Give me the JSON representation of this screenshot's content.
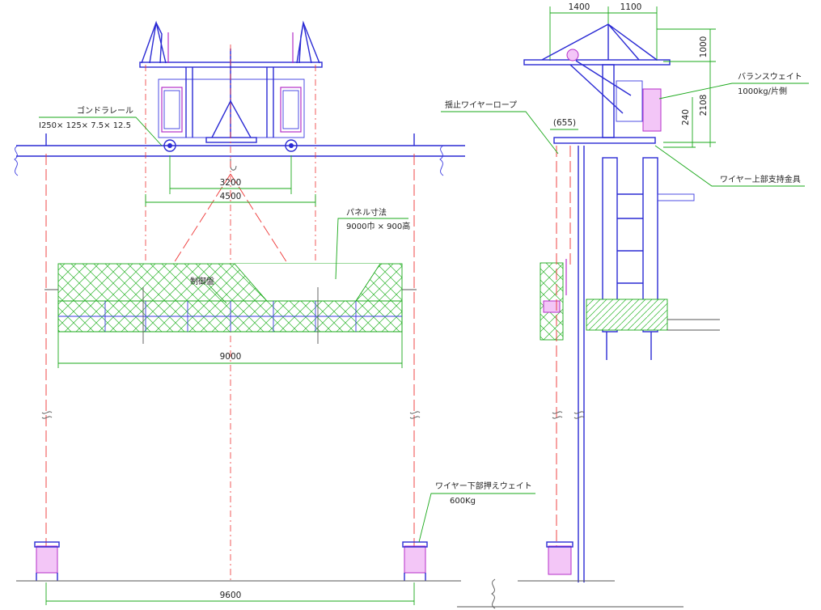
{
  "front_view": {
    "rail_label": "ゴンドラレール",
    "rail_spec": "I250× 125× 7.5× 12.5",
    "dim_inner": "3200",
    "dim_outer": "4500",
    "panel_label": "パネル寸法",
    "panel_size": "9000巾 × 900高",
    "control_panel": "制御盤",
    "dim_panel": "9000",
    "weight_label": "ワイヤー下部押えウェイト",
    "weight_value": "600Kg",
    "dim_total": "9600"
  },
  "side_view": {
    "dim_a": "1400",
    "dim_b": "1100",
    "dim_height1": "1000",
    "dim_height2": "2108",
    "dim_height3": "240",
    "dim_offset": "(655)",
    "balance_label": "バランスウェイト",
    "balance_value": "1000kg/片側",
    "rope_label": "揺止ワイヤーロープ",
    "support_label": "ワイヤー上部支持金具"
  }
}
